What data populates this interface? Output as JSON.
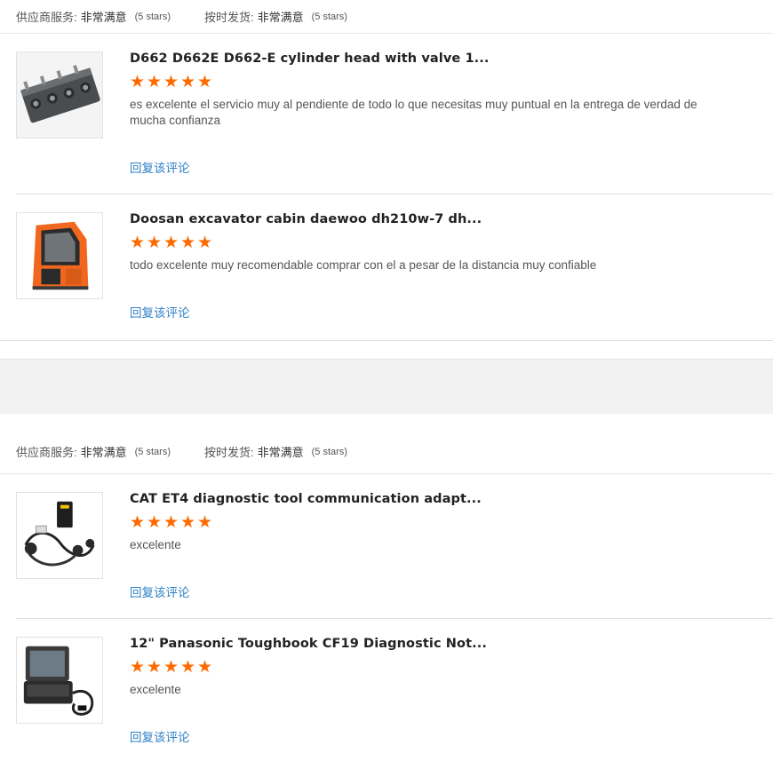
{
  "sections": [
    {
      "rating_bar": {
        "supplier_label": "供应商服务:",
        "supplier_value": "非常满意",
        "supplier_stars": "(5 stars)",
        "shipping_label": "按时发货:",
        "shipping_value": "非常满意",
        "shipping_stars": "(5 stars)"
      },
      "reviews": [
        {
          "title": "D662 D662E D662-E cylinder head with valve 1...",
          "stars": 5,
          "comment": "es excelente el servicio muy al pendiente de todo lo que necesitas muy puntual en la entrega de verdad de mucha confianza",
          "reply": "回复该评论",
          "image": "cylinder-head-product-image"
        },
        {
          "title": "Doosan excavator cabin daewoo dh210w-7 dh...",
          "stars": 5,
          "comment": "todo excelente muy recomendable comprar con el a pesar de la distancia muy confiable",
          "reply": "回复该评论",
          "image": "excavator-cabin-product-image"
        }
      ]
    },
    {
      "rating_bar": {
        "supplier_label": "供应商服务:",
        "supplier_value": "非常满意",
        "supplier_stars": "(5 stars)",
        "shipping_label": "按时发货:",
        "shipping_value": "非常满意",
        "shipping_stars": "(5 stars)"
      },
      "reviews": [
        {
          "title": "CAT ET4 diagnostic tool communication adapt...",
          "stars": 5,
          "comment": "excelente",
          "reply": "回复该评论",
          "image": "diagnostic-adapter-product-image"
        },
        {
          "title": "12\" Panasonic Toughbook CF19 Diagnostic Not...",
          "stars": 5,
          "comment": "excelente",
          "reply": "回复该评论",
          "image": "toughbook-laptop-product-image"
        }
      ]
    }
  ],
  "colors": {
    "star": "#ff6a00",
    "link": "#2f80c4",
    "divider": "#dcdcdc",
    "gap_background": "#f2f2f2"
  }
}
